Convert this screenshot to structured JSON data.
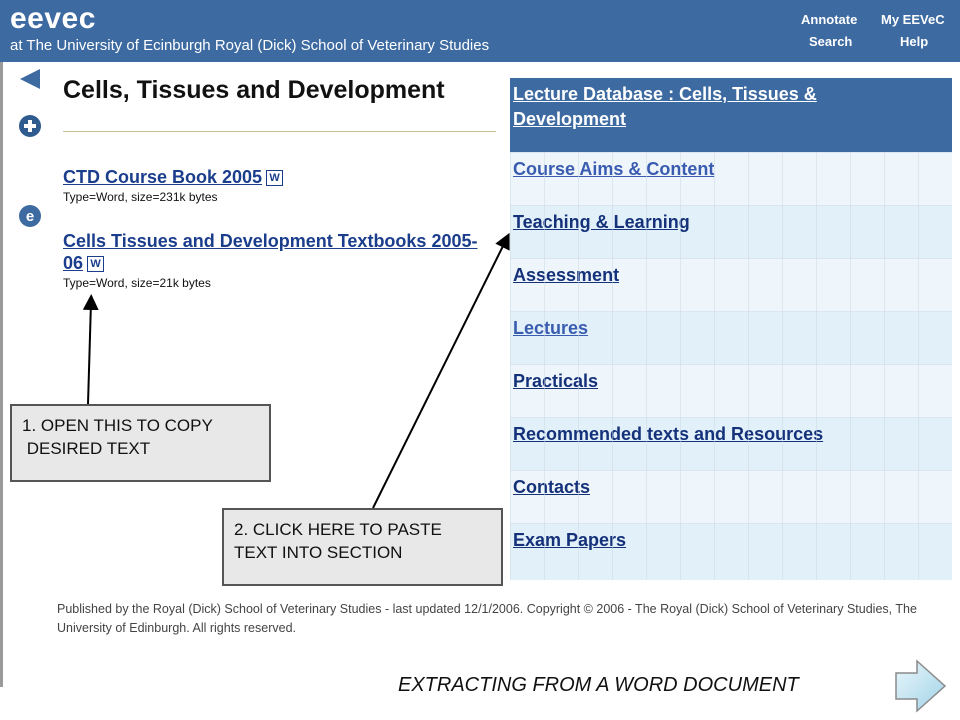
{
  "header": {
    "brand": "eevec",
    "subtitle": "at The University of Ecinburgh Royal (Dick) School of Veterinary Studies",
    "nav": {
      "annotate": "Annotate",
      "my_eevec": "My EEVeC",
      "search": "Search",
      "help": "Help"
    },
    "color": "#3d6aa0"
  },
  "page": {
    "title": "Cells, Tissues and Development",
    "icons": [
      "back-arrow-icon",
      "add-icon",
      "e-icon"
    ]
  },
  "documents": [
    {
      "title": "CTD Course Book 2005",
      "meta": "Type=Word, size=231k bytes",
      "icon": "word-icon"
    },
    {
      "title": "Cells Tissues and Development Textbooks 2005-06",
      "meta": "Type=Word, size=21k bytes",
      "icon": "word-icon"
    }
  ],
  "database": {
    "title": "Lecture Database : Cells, Tissues & Development",
    "sections": [
      "Course Aims & Content",
      "Teaching & Learning",
      "Assessment",
      "Lectures",
      "Practicals",
      "Recommended texts and Resources",
      "Contacts",
      "Exam Papers"
    ]
  },
  "footer": {
    "text": "Published by the Royal (Dick) School of Veterinary Studies - last updated 12/1/2006. Copyright © 2006 - The Royal (Dick) School of Veterinary Studies, The University of Edinburgh. All rights reserved."
  },
  "callouts": {
    "one": "1. OPEN THIS TO COPY\n DESIRED TEXT",
    "two": "2. CLICK HERE TO PASTE\nTEXT INTO SECTION"
  },
  "caption": "EXTRACTING FROM A WORD DOCUMENT",
  "next_button": "next-arrow-icon"
}
